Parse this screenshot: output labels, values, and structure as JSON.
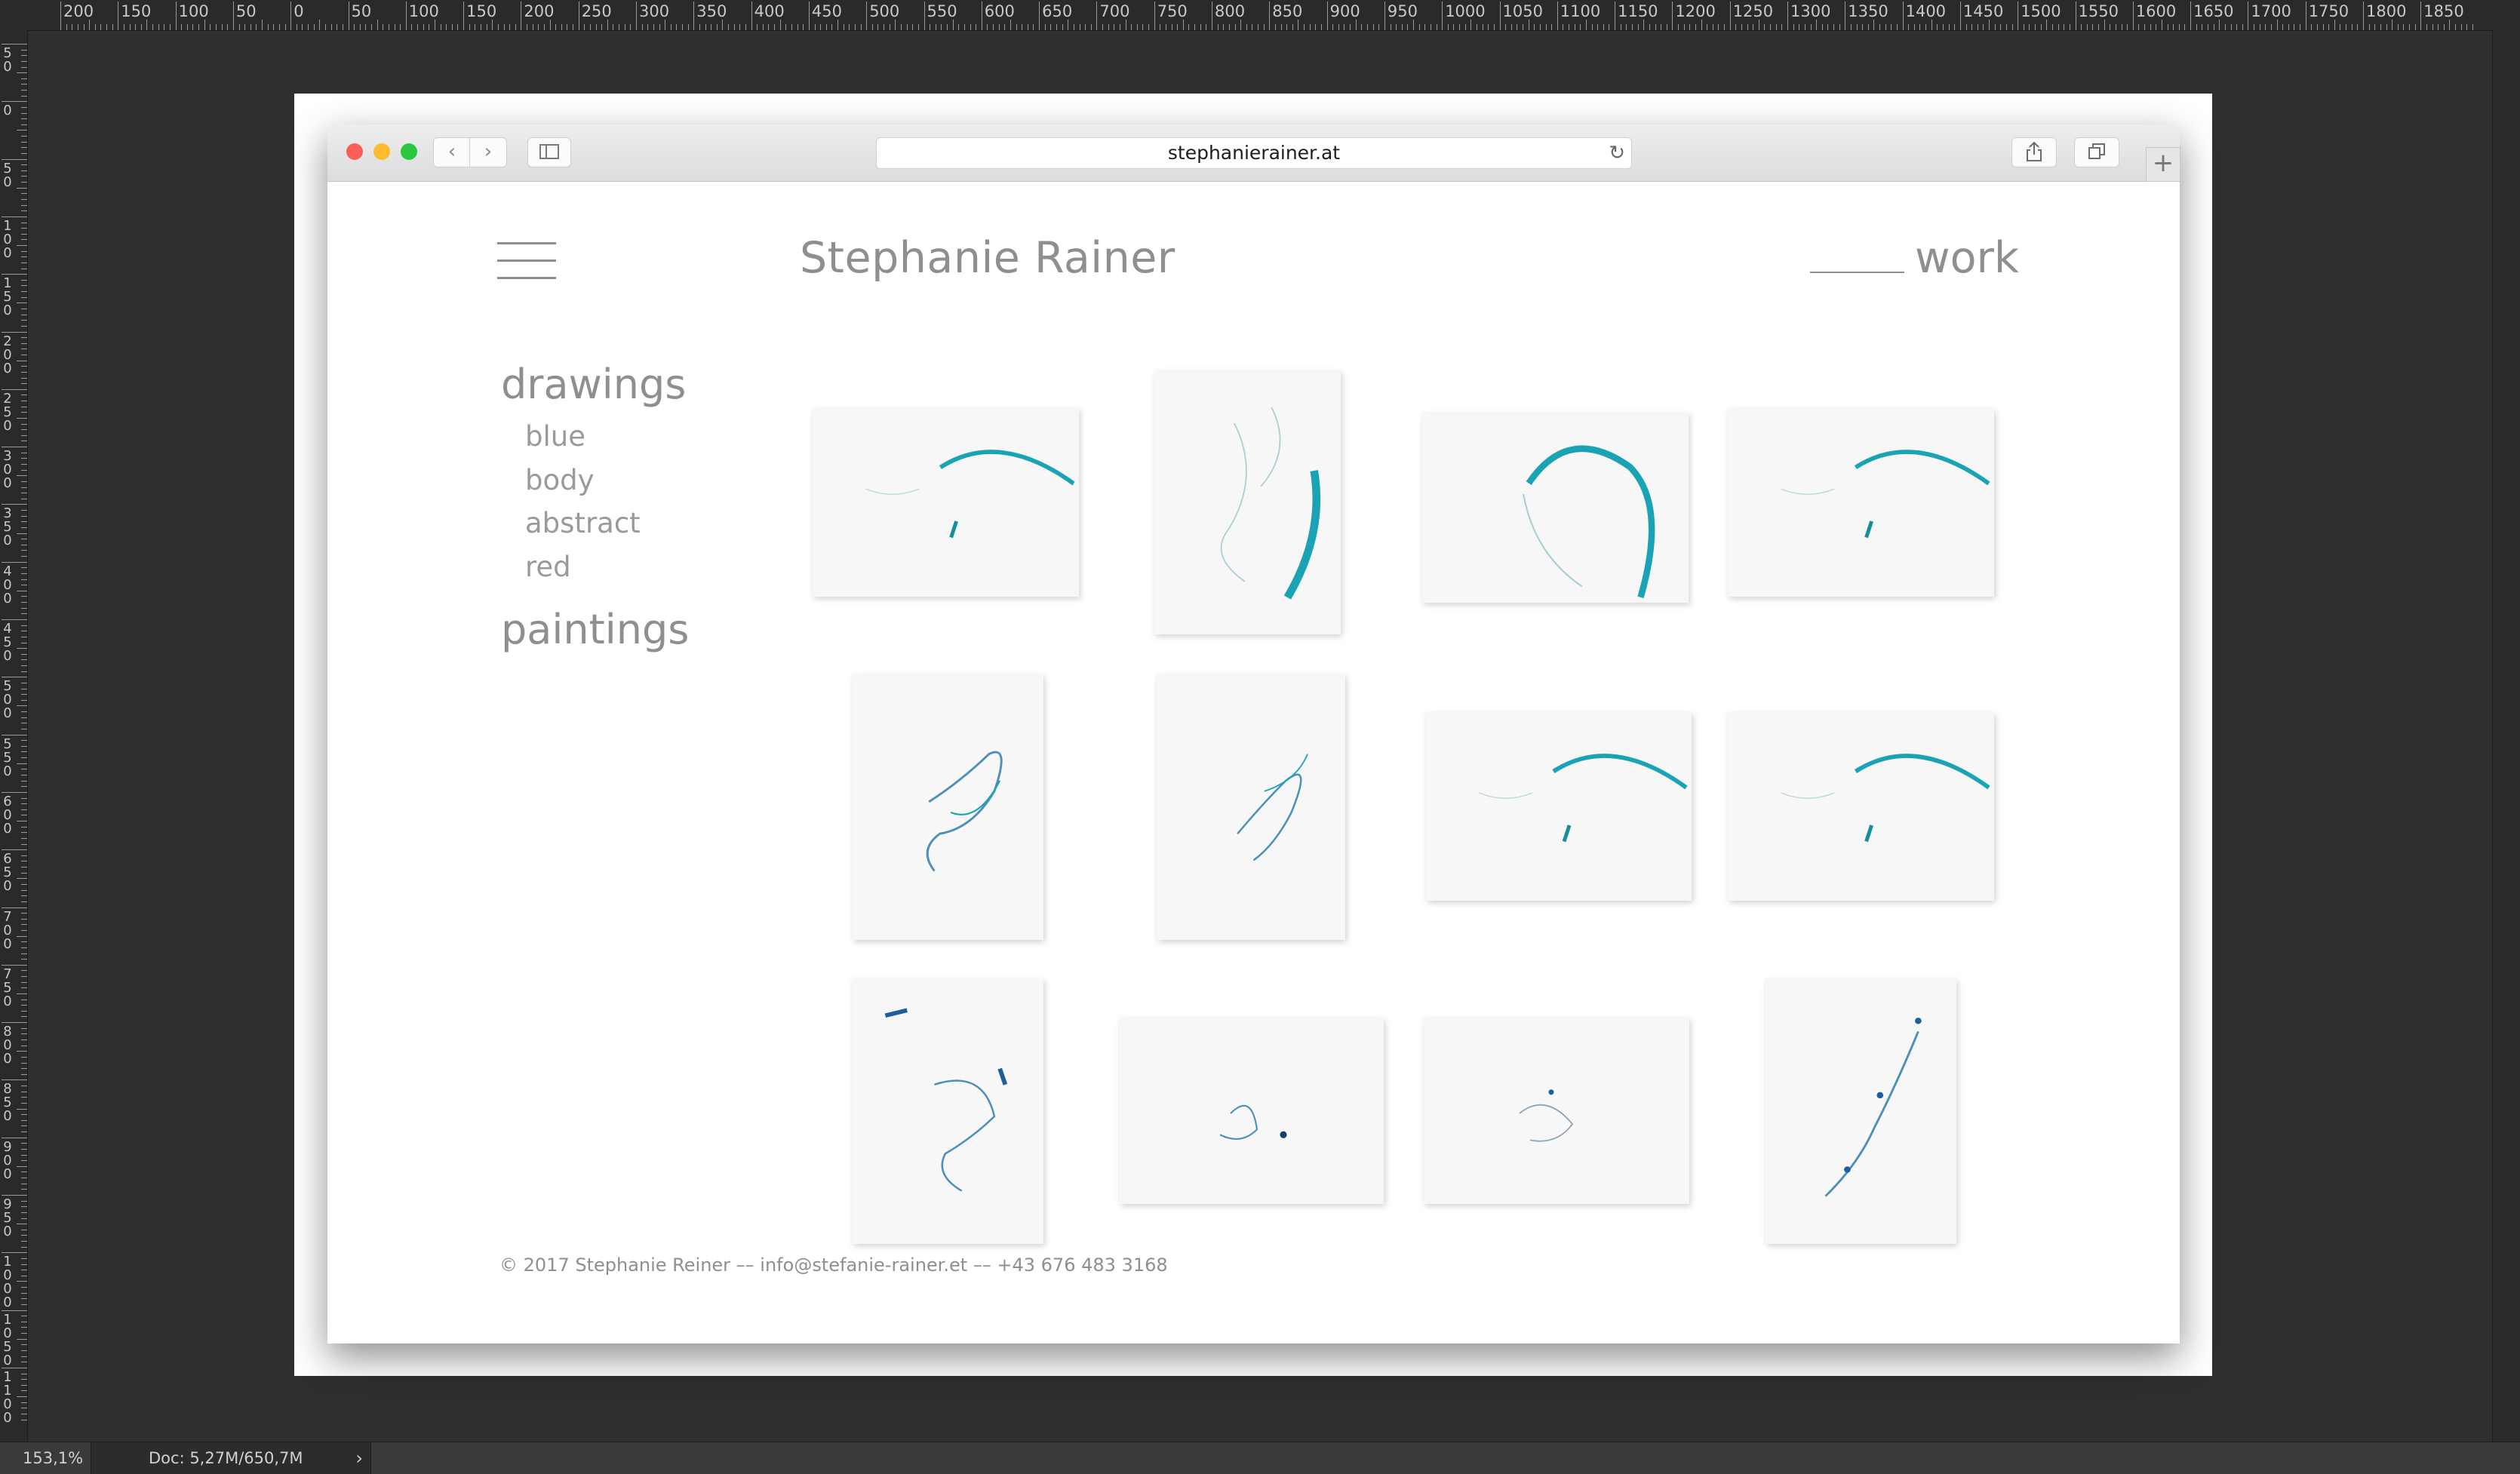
{
  "app": {
    "ruler_labels": [
      "200",
      "150",
      "100",
      "50",
      "0",
      "50",
      "100",
      "150",
      "200",
      "250",
      "300",
      "350",
      "400",
      "450",
      "500",
      "550",
      "600",
      "650",
      "700",
      "750",
      "800",
      "850",
      "900",
      "950",
      "1000",
      "1050",
      "1100",
      "1150",
      "1200",
      "1250",
      "1300",
      "1350",
      "1400",
      "1450",
      "1500",
      "1550",
      "1600",
      "1650",
      "1700",
      "1750",
      "1800",
      "1850"
    ],
    "left_ruler_labels": [
      "50",
      "0",
      "50",
      "100",
      "150",
      "200",
      "250",
      "300",
      "350",
      "400",
      "450",
      "500",
      "550",
      "600",
      "650",
      "700",
      "750",
      "800",
      "850",
      "900",
      "950",
      "1000",
      "1050",
      "1100"
    ],
    "status": {
      "zoom": "153,1%",
      "doc": "Doc: 5,27M/650,7M",
      "arrow": "›"
    }
  },
  "browser": {
    "url": "stephanierainer.at",
    "icons": {
      "back": "chevron-left-icon",
      "forward": "chevron-right-icon",
      "sidebar": "sidebar-icon",
      "reload": "reload-icon",
      "share": "share-icon",
      "tabs": "tabs-icon",
      "new_tab": "plus-icon"
    },
    "glyphs": {
      "back": "‹",
      "forward": "›",
      "reload": "↻",
      "new_tab": "+"
    }
  },
  "site": {
    "title": "Stephanie Rainer",
    "work_label": "work",
    "nav": {
      "drawings": "drawings",
      "sub": [
        "blue",
        "body",
        "abstract",
        "red"
      ],
      "paintings": "paintings"
    },
    "footer": "© 2017 Stephanie Reiner –– info@stefanie-rainer.et –– +43 676 483 3168",
    "accent_color": "#1aa3b5"
  }
}
